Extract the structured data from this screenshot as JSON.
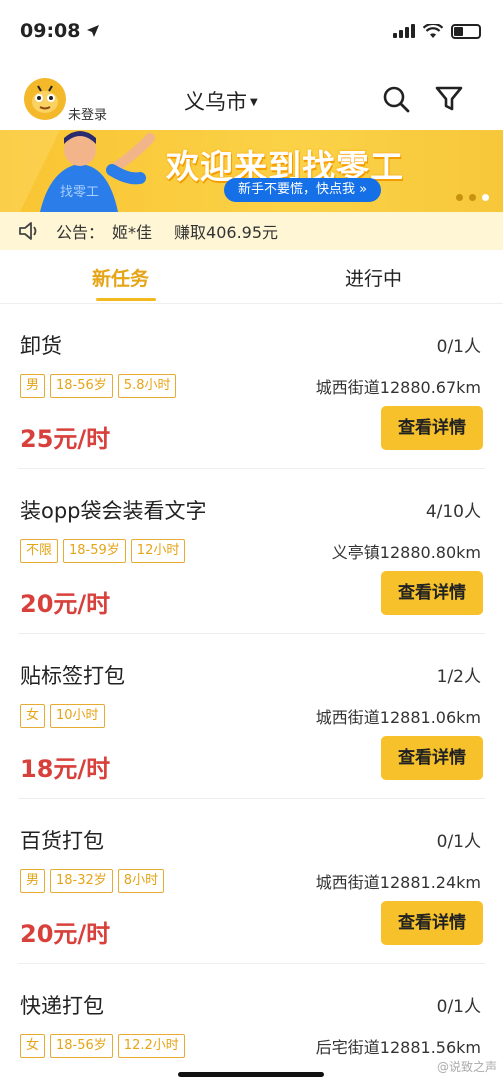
{
  "status": {
    "time": "09:08"
  },
  "header": {
    "login": "未登录",
    "city": "义乌市"
  },
  "banner": {
    "title": "欢迎来到找零工",
    "subtitle": "新手不要慌，快点我 »",
    "mascot_text": "找零工"
  },
  "notice": {
    "label": "公告：",
    "name": "姬*佳",
    "earn": "赚取406.95元"
  },
  "tabs": [
    {
      "label": "新任务"
    },
    {
      "label": "进行中"
    }
  ],
  "tasks": [
    {
      "title": "卸货",
      "count": "0/1人",
      "tags": [
        "男",
        "18-56岁",
        "5.8小时"
      ],
      "location": "城西街道12880.67km",
      "wage": "25元/时",
      "button": "查看详情"
    },
    {
      "title": "装opp袋会装看文字",
      "count": "4/10人",
      "tags": [
        "不限",
        "18-59岁",
        "12小时"
      ],
      "location": "义亭镇12880.80km",
      "wage": "20元/时",
      "button": "查看详情"
    },
    {
      "title": "贴标签打包",
      "count": "1/2人",
      "tags": [
        "女",
        "10小时"
      ],
      "location": "城西街道12881.06km",
      "wage": "18元/时",
      "button": "查看详情"
    },
    {
      "title": "百货打包",
      "count": "0/1人",
      "tags": [
        "男",
        "18-32岁",
        "8小时"
      ],
      "location": "城西街道12881.24km",
      "wage": "20元/时",
      "button": "查看详情"
    },
    {
      "title": "快递打包",
      "count": "0/1人",
      "tags": [
        "女",
        "18-56岁",
        "12.2小时"
      ],
      "location": "后宅街道12881.56km",
      "wage": "",
      "button": ""
    }
  ],
  "watermark": "@说致之声",
  "colors": {
    "accent": "#f6c12b",
    "wage": "#d8403b",
    "tag": "#e6a417",
    "banner_pill": "#1570e8"
  }
}
